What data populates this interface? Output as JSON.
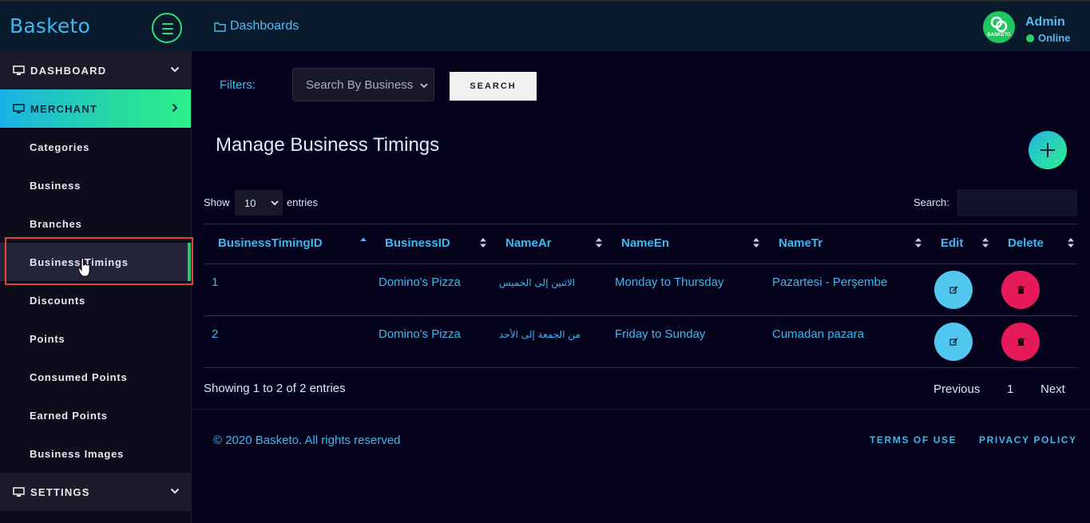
{
  "header": {
    "brand": "Basketo",
    "breadcrumb": "Dashboards",
    "user": {
      "name": "Admin",
      "status": "Online",
      "avatar_label": "BASKETO"
    }
  },
  "sidebar": {
    "dashboard": "DASHBOARD",
    "merchant": "MERCHANT",
    "settings": "SETTINGS",
    "items": [
      {
        "label": "Categories"
      },
      {
        "label": "Business"
      },
      {
        "label": "Branches"
      },
      {
        "label": "Business Timings"
      },
      {
        "label": "Discounts"
      },
      {
        "label": "Points"
      },
      {
        "label": "Consumed Points"
      },
      {
        "label": "Earned Points"
      },
      {
        "label": "Business Images"
      }
    ]
  },
  "filters": {
    "label": "Filters:",
    "select_value": "Search By Business",
    "search_button": "SEARCH"
  },
  "page_title": "Manage Business Timings",
  "table_controls": {
    "show": "Show",
    "page_size": "10",
    "entries": "entries",
    "search_label": "Search:"
  },
  "table": {
    "headers": [
      "BusinessTimingID",
      "BusinessID",
      "NameAr",
      "NameEn",
      "NameTr",
      "Edit",
      "Delete"
    ],
    "rows": [
      [
        "1",
        "Domino's Pizza",
        "الاثنين إلى الخميس",
        "Monday to Thursday",
        "Pazartesi - Perşembe"
      ],
      [
        "2",
        "Domino's Pizza",
        "من الجمعة إلى الأحد",
        "Friday to Sunday",
        "Cumadan pazara"
      ]
    ]
  },
  "pagination": {
    "info": "Showing 1 to 2 of 2 entries",
    "previous": "Previous",
    "page": "1",
    "next": "Next"
  },
  "footer": {
    "copyright": "© 2020 Basketo. All rights reserved",
    "terms": "TERMS OF USE",
    "privacy": "PRIVACY POLICY"
  },
  "colors": {
    "accent": "#3db8f0",
    "green": "#27e07a",
    "background": "#03021a",
    "edit": "#52c8f0",
    "delete": "#e6195a"
  }
}
